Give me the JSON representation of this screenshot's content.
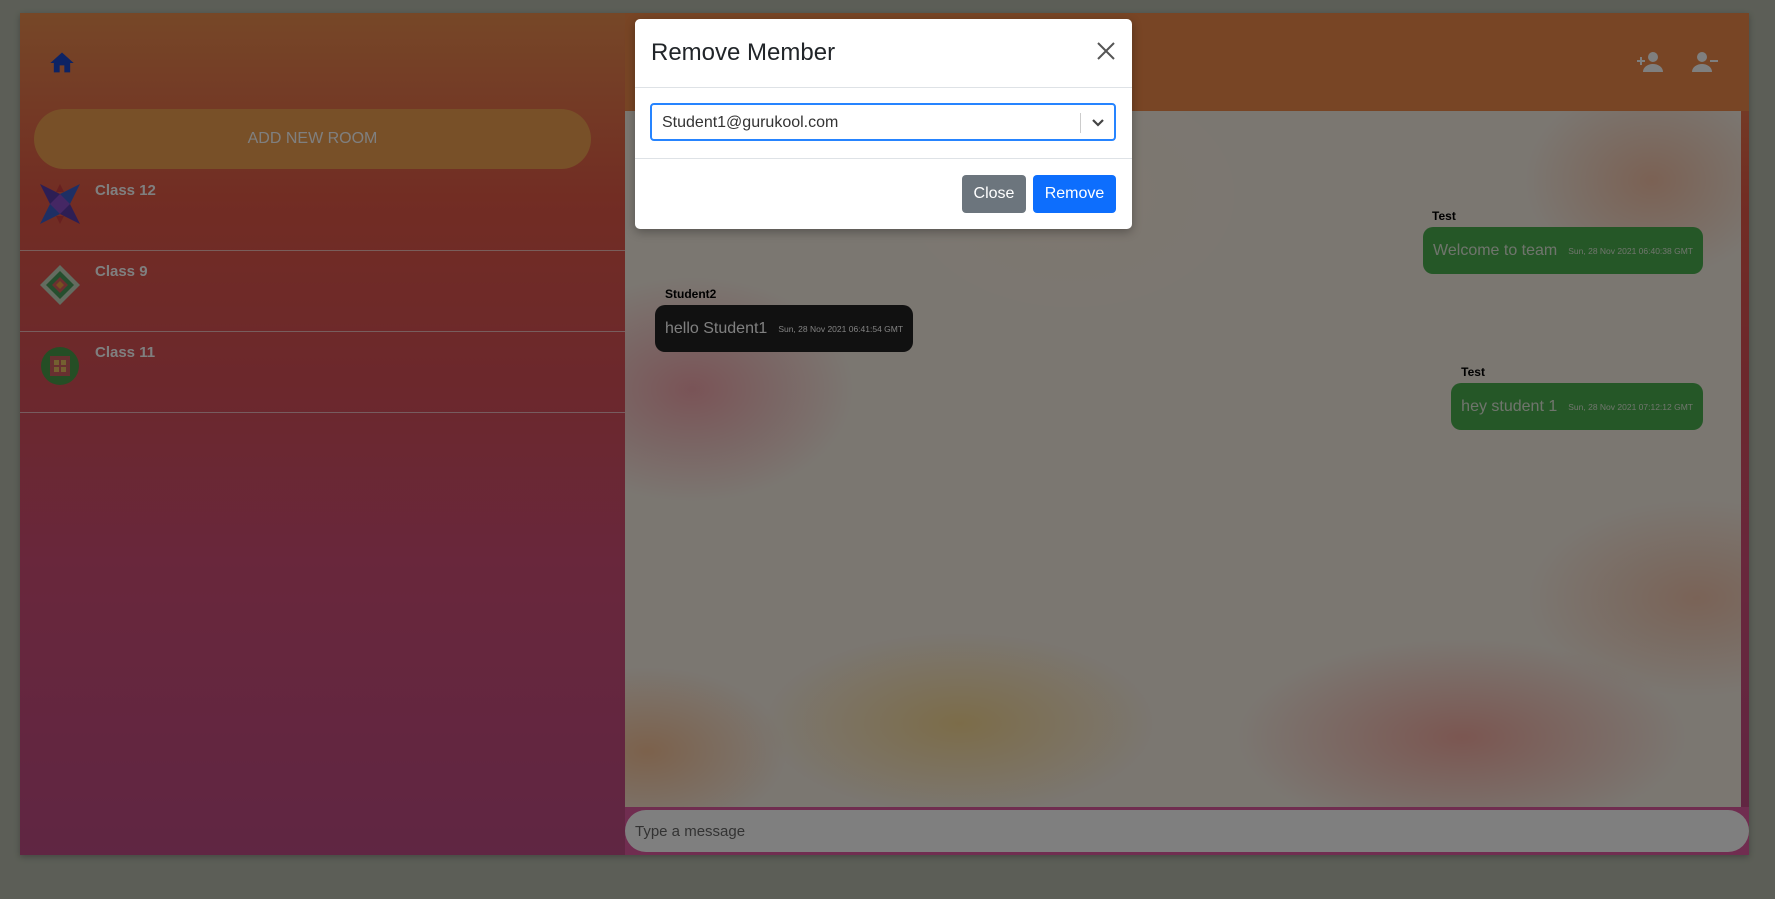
{
  "sidebar": {
    "add_room_label": "ADD NEW ROOM",
    "rooms": [
      {
        "name": "Class 12"
      },
      {
        "name": "Class 9"
      },
      {
        "name": "Class 11"
      }
    ]
  },
  "chat": {
    "messages": [
      {
        "sender": "Test",
        "text": "Welcome to team",
        "time": "Sun, 28 Nov 2021 06:40:38 GMT",
        "side": "right"
      },
      {
        "sender": "Student2",
        "text": "hello Student1",
        "time": "Sun, 28 Nov 2021 06:41:54 GMT",
        "side": "left"
      },
      {
        "sender": "Test",
        "text": "hey student 1",
        "time": "Sun, 28 Nov 2021 07:12:12 GMT",
        "side": "right"
      }
    ],
    "input_placeholder": "Type a message"
  },
  "modal": {
    "title": "Remove Member",
    "selected_member": "Student1@gurukool.com",
    "close_label": "Close",
    "remove_label": "Remove"
  },
  "colors": {
    "accent_blue": "#0d6efd",
    "sent_bubble": "#4aaf4f",
    "received_bubble": "#222222",
    "header_orange": "#f08a4a"
  },
  "icons": {
    "home": "home-icon",
    "add_member": "person-add-icon",
    "remove_member": "person-remove-icon",
    "close": "close-icon",
    "dropdown": "chevron-down-icon"
  }
}
